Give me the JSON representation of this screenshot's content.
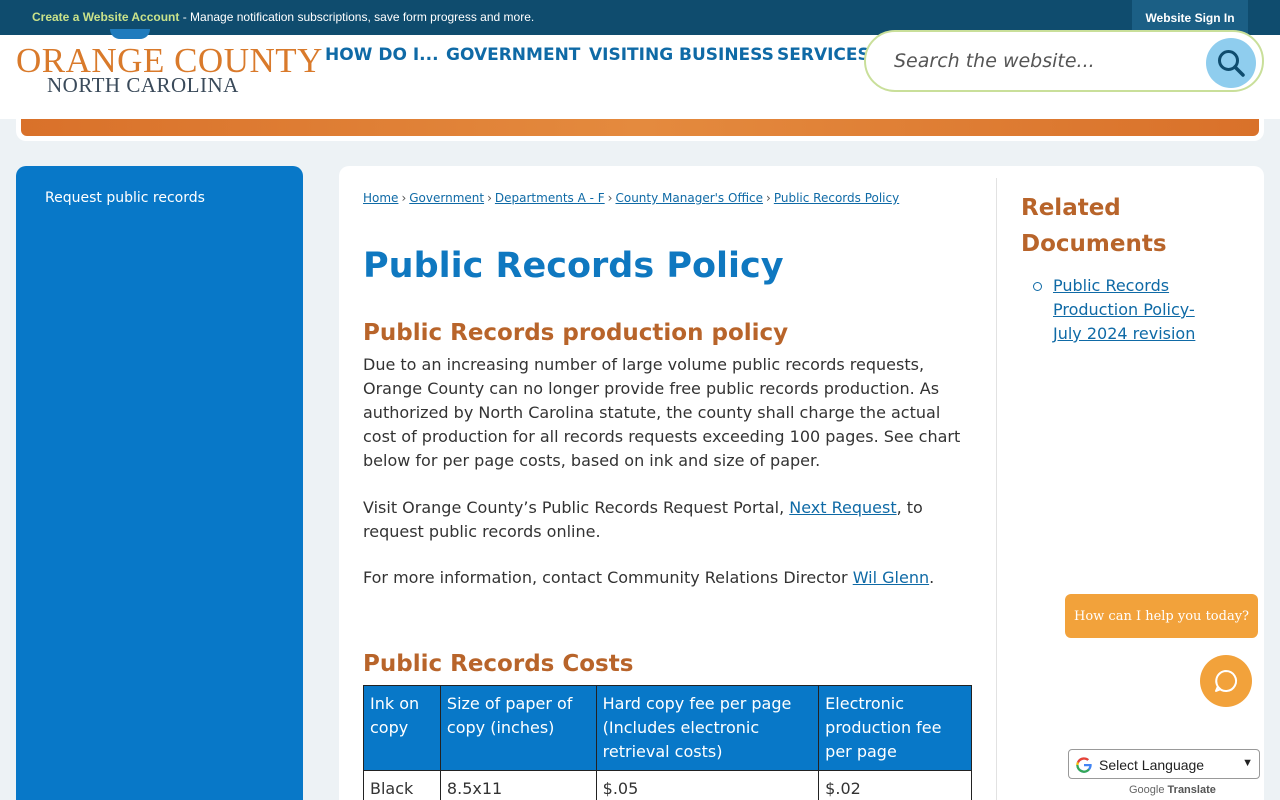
{
  "topbar": {
    "account_link": "Create a Website Account",
    "message": " - Manage notification subscriptions, save form progress and more.",
    "sign_in": "Website Sign In"
  },
  "logo": {
    "main": "ORANGE COUNTY",
    "sub": "NORTH CAROLINA"
  },
  "nav": [
    "HOW DO I...",
    "GOVERNMENT",
    "VISITING",
    "BUSINESS",
    "SERVICES"
  ],
  "search": {
    "placeholder": "Search the website..."
  },
  "sidebar": {
    "items": [
      {
        "label": "Request public records"
      }
    ]
  },
  "breadcrumb": [
    "Home",
    "Government",
    "Departments A - F",
    "County Manager's Office",
    "Public Records Policy"
  ],
  "page_title": "Public Records Policy",
  "section1": {
    "heading": "Public Records production policy",
    "body": "Due to an increasing number of large volume public records requests, Orange County can no longer provide free public records production. As authorized by North Carolina statute, the county shall charge the actual cost of production for all records requests exceeding 100 pages. See chart below for per page costs, based on ink and size of paper.",
    "portal_pre": "Visit Orange County’s Public Records Request Portal, ",
    "portal_link": "Next Request",
    "portal_post": ", to request public records online.",
    "contact_pre": "For more information, contact Community Relations Director ",
    "contact_link": "Wil Glenn",
    "contact_post": "."
  },
  "costs": {
    "heading": "Public Records Costs",
    "headers": [
      "Ink on copy",
      "Size of paper of copy (inches)",
      "Hard copy fee per page (Includes electronic retrieval costs)",
      "Electronic production fee per page"
    ],
    "rows": [
      [
        "Black",
        "8.5x11",
        "$.05",
        "$.02"
      ]
    ]
  },
  "related": {
    "title": "Related Documents",
    "items": [
      "Public Records Production Policy-July 2024 revision"
    ]
  },
  "chat": {
    "prompt": "How can I help you today?"
  },
  "translate": {
    "select_label": "Select Language",
    "powered_by": "Google",
    "translate_label": "Translate"
  }
}
